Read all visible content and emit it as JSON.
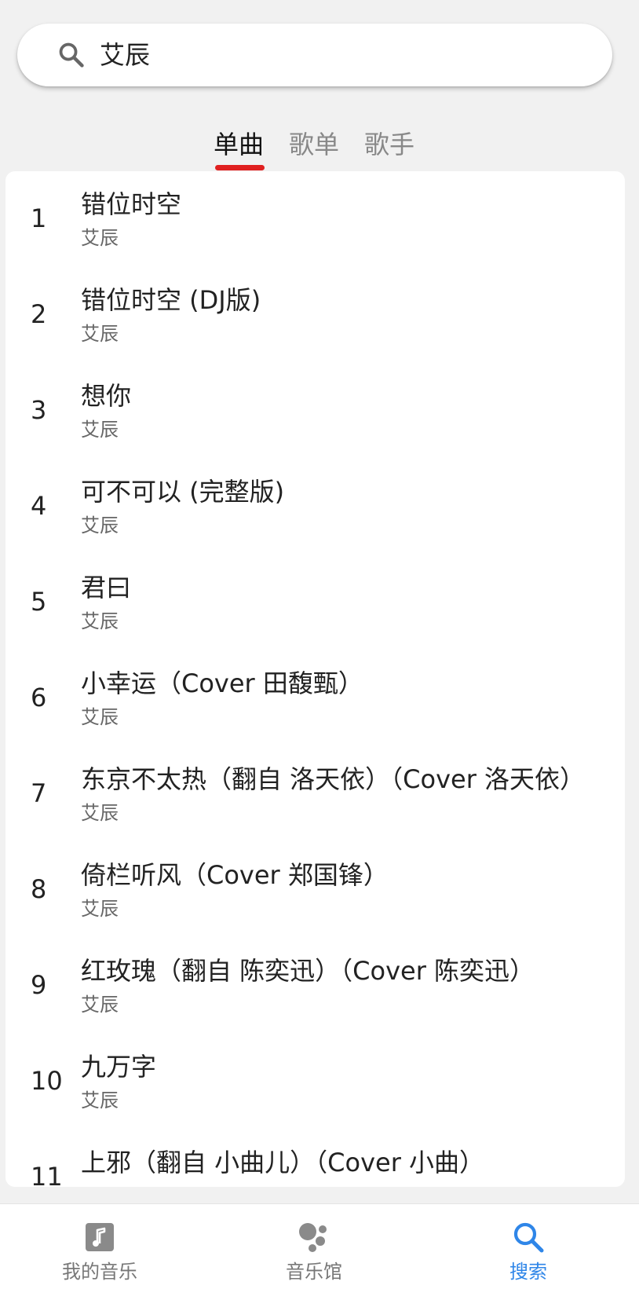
{
  "search": {
    "query": "艾辰"
  },
  "tabs": [
    {
      "label": "单曲",
      "active": true
    },
    {
      "label": "歌单",
      "active": false
    },
    {
      "label": "歌手",
      "active": false
    }
  ],
  "songs": [
    {
      "num": "1",
      "title": "错位时空",
      "artist": "艾辰"
    },
    {
      "num": "2",
      "title": "错位时空 (DJ版)",
      "artist": "艾辰"
    },
    {
      "num": "3",
      "title": "想你",
      "artist": "艾辰"
    },
    {
      "num": "4",
      "title": "可不可以 (完整版)",
      "artist": "艾辰"
    },
    {
      "num": "5",
      "title": "君曰",
      "artist": "艾辰"
    },
    {
      "num": "6",
      "title": "小幸运（Cover 田馥甄）",
      "artist": "艾辰"
    },
    {
      "num": "7",
      "title": "东京不太热（翻自 洛天依）（Cover 洛天依）",
      "artist": "艾辰"
    },
    {
      "num": "8",
      "title": "倚栏听风（Cover 郑国锋）",
      "artist": "艾辰"
    },
    {
      "num": "9",
      "title": "红玫瑰（翻自 陈奕迅）（Cover 陈奕迅）",
      "artist": "艾辰"
    },
    {
      "num": "10",
      "title": "九万字",
      "artist": "艾辰"
    },
    {
      "num": "11",
      "title": "上邪（翻自 小曲儿）（Cover 小曲）",
      "artist": ""
    }
  ],
  "bottom_nav": [
    {
      "label": "我的音乐",
      "icon": "music-note-icon",
      "active": false
    },
    {
      "label": "音乐馆",
      "icon": "music-hall-icon",
      "active": false
    },
    {
      "label": "搜索",
      "icon": "search-icon",
      "active": true
    }
  ],
  "colors": {
    "accent_red": "#e02020",
    "accent_blue": "#2f86e8",
    "background": "#f1f1f1"
  }
}
